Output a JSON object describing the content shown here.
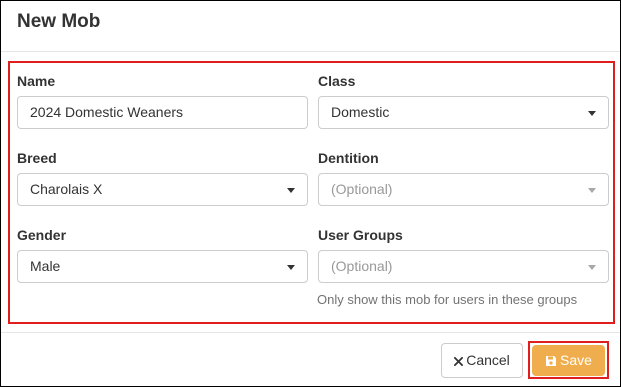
{
  "modal": {
    "title": "New Mob"
  },
  "form": {
    "name": {
      "label": "Name",
      "value": "2024 Domestic Weaners"
    },
    "class": {
      "label": "Class",
      "value": "Domestic"
    },
    "breed": {
      "label": "Breed",
      "value": "Charolais X"
    },
    "dentition": {
      "label": "Dentition",
      "placeholder": "(Optional)"
    },
    "gender": {
      "label": "Gender",
      "value": "Male"
    },
    "user_groups": {
      "label": "User Groups",
      "placeholder": "(Optional)",
      "help": "Only show this mob for users in these groups"
    }
  },
  "footer": {
    "cancel_label": "Cancel",
    "save_label": "Save"
  },
  "colors": {
    "save_button": "#f0ad4e",
    "highlight_border": "#e01e1e",
    "border": "#cccccc"
  },
  "icons": {
    "cancel": "close-icon",
    "save": "floppy-disk-icon",
    "dropdown": "caret-down-icon"
  }
}
